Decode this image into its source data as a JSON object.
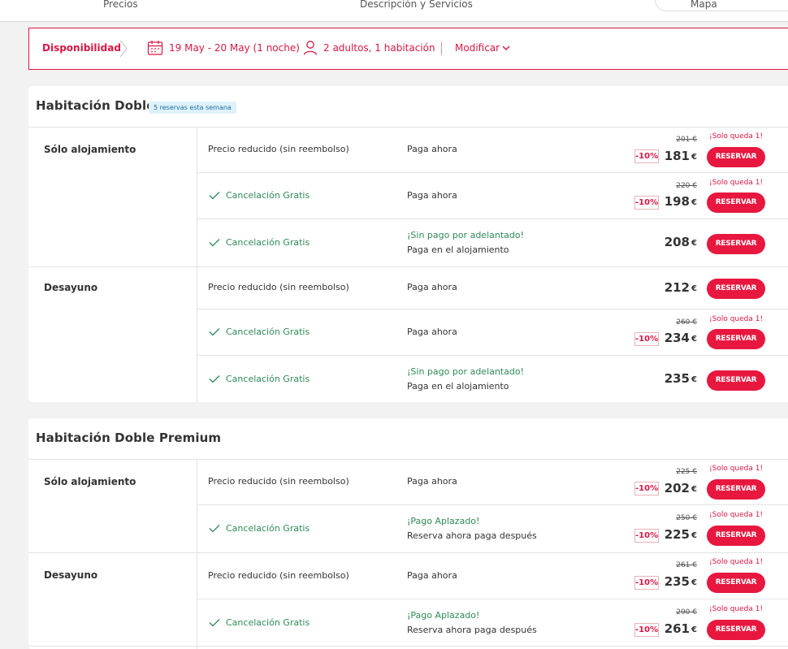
{
  "nav": {
    "tab1": "Precios",
    "tab2": "Descripción y Servicios",
    "tab3": "Mapa"
  },
  "availability": {
    "label": "Disponibilidad",
    "dates": "19 May - 20 May (1 noche)",
    "guests": "2 adultos, 1 habitación",
    "modify": "Modificar"
  },
  "brand_color": "#e8173f",
  "common": {
    "reduced": "Precio reducido (sin reembolso)",
    "free_cancel": "Cancelación Gratis",
    "pay_now": "Paga ahora",
    "no_prepay": "¡Sin pago por adelantado!",
    "pay_at_hotel": "Paga en el alojamiento",
    "deferred": "¡Pago Aplazado!",
    "book_now_pay_later": "Reserva ahora paga después",
    "only_left": "¡Solo queda 1!",
    "discount": "-10%",
    "currency": "€",
    "book": "RESERVAR",
    "board_room_only": "Sólo alojamiento",
    "board_breakfast": "Desayuno"
  },
  "room1": {
    "title": "Habitación Doble",
    "badge": "5 reservas esta semana",
    "r1": {
      "old": "201 €",
      "price": "181"
    },
    "r2": {
      "old": "220 €",
      "price": "198"
    },
    "r3": {
      "price": "208"
    },
    "r4": {
      "price": "212"
    },
    "r5": {
      "old": "260 €",
      "price": "234"
    },
    "r6": {
      "price": "235"
    }
  },
  "room2": {
    "title": "Habitación Doble Premium",
    "r1": {
      "old": "225 €",
      "price": "202"
    },
    "r2": {
      "old": "250 €",
      "price": "225"
    },
    "r3": {
      "old": "261 €",
      "price": "235"
    },
    "r4": {
      "old": "290 €",
      "price": "261"
    }
  }
}
